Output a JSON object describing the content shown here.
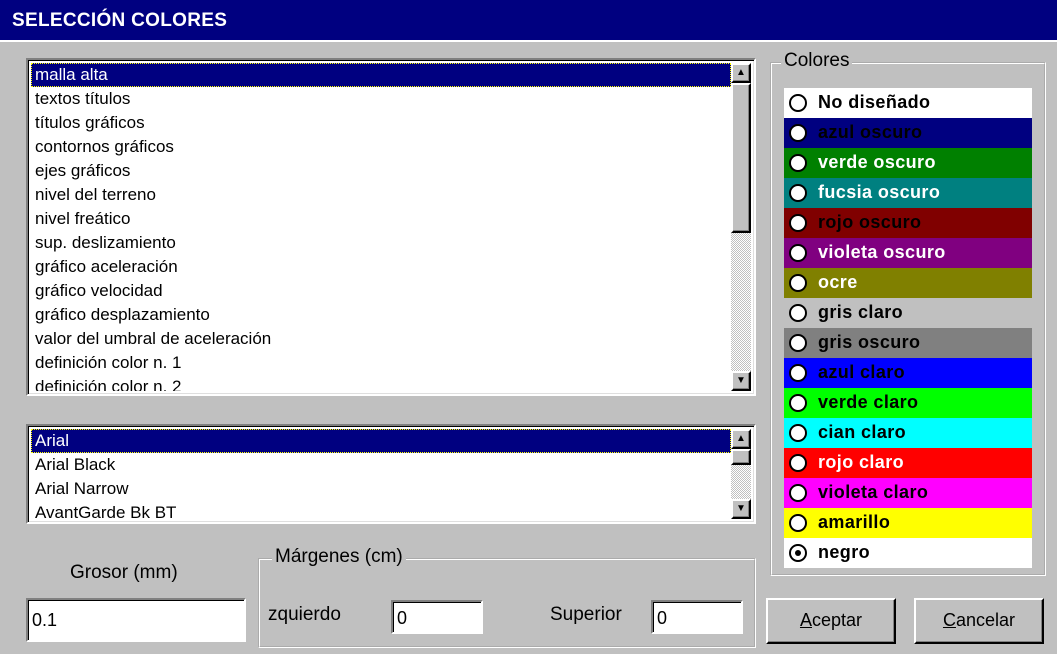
{
  "window": {
    "title": "SELECCIÓN COLORES"
  },
  "elements_list": {
    "items": [
      "malla alta",
      "textos títulos",
      "títulos gráficos",
      "contornos gráficos",
      "ejes gráficos",
      "nivel del terreno",
      "nivel freático",
      "sup. deslizamiento",
      "gráfico aceleración",
      "gráfico velocidad",
      "gráfico desplazamiento",
      "valor del umbral de aceleración",
      "definición color n. 1",
      "definición color n. 2"
    ],
    "selected_index": 0
  },
  "fonts_list": {
    "items": [
      "Arial",
      "Arial Black",
      "Arial Narrow",
      "AvantGarde Bk BT"
    ],
    "selected_index": 0
  },
  "colors_group": {
    "legend": "Colores",
    "options": [
      {
        "label": "No diseñado",
        "bg": "#ffffff",
        "fg": "#000000",
        "checked": false
      },
      {
        "label": "azul oscuro",
        "bg": "#000080",
        "fg": "#000000",
        "checked": false
      },
      {
        "label": "verde oscuro",
        "bg": "#008000",
        "fg": "#ffffff",
        "checked": false
      },
      {
        "label": "fucsia oscuro",
        "bg": "#008080",
        "fg": "#ffffff",
        "checked": false
      },
      {
        "label": "rojo oscuro",
        "bg": "#800000",
        "fg": "#000000",
        "checked": false
      },
      {
        "label": "violeta oscuro",
        "bg": "#800080",
        "fg": "#ffffff",
        "checked": false
      },
      {
        "label": "ocre",
        "bg": "#808000",
        "fg": "#ffffff",
        "checked": false
      },
      {
        "label": "gris claro",
        "bg": "#c0c0c0",
        "fg": "#000000",
        "checked": false
      },
      {
        "label": "gris oscuro",
        "bg": "#808080",
        "fg": "#000000",
        "checked": false
      },
      {
        "label": "azul claro",
        "bg": "#0000ff",
        "fg": "#000000",
        "checked": false
      },
      {
        "label": "verde claro",
        "bg": "#00ff00",
        "fg": "#000000",
        "checked": false
      },
      {
        "label": "cian claro",
        "bg": "#00ffff",
        "fg": "#000000",
        "checked": false
      },
      {
        "label": "rojo claro",
        "bg": "#ff0000",
        "fg": "#ffffff",
        "checked": false
      },
      {
        "label": "violeta claro",
        "bg": "#ff00ff",
        "fg": "#000000",
        "checked": false
      },
      {
        "label": "amarillo",
        "bg": "#ffff00",
        "fg": "#000000",
        "checked": false
      },
      {
        "label": "negro",
        "bg": "#ffffff",
        "fg": "#000000",
        "checked": true
      }
    ]
  },
  "thickness": {
    "label": "Grosor (mm)",
    "value": "0.1"
  },
  "margins": {
    "legend": "Márgenes (cm)",
    "left_label": "zquierdo",
    "left_value": "0",
    "top_label": "Superior",
    "top_value": "0"
  },
  "buttons": {
    "accept_accel": "A",
    "accept_rest": "ceptar",
    "cancel_accel": "C",
    "cancel_rest": "ancelar"
  },
  "icons": {
    "scroll_up": "▲",
    "scroll_down": "▼"
  }
}
